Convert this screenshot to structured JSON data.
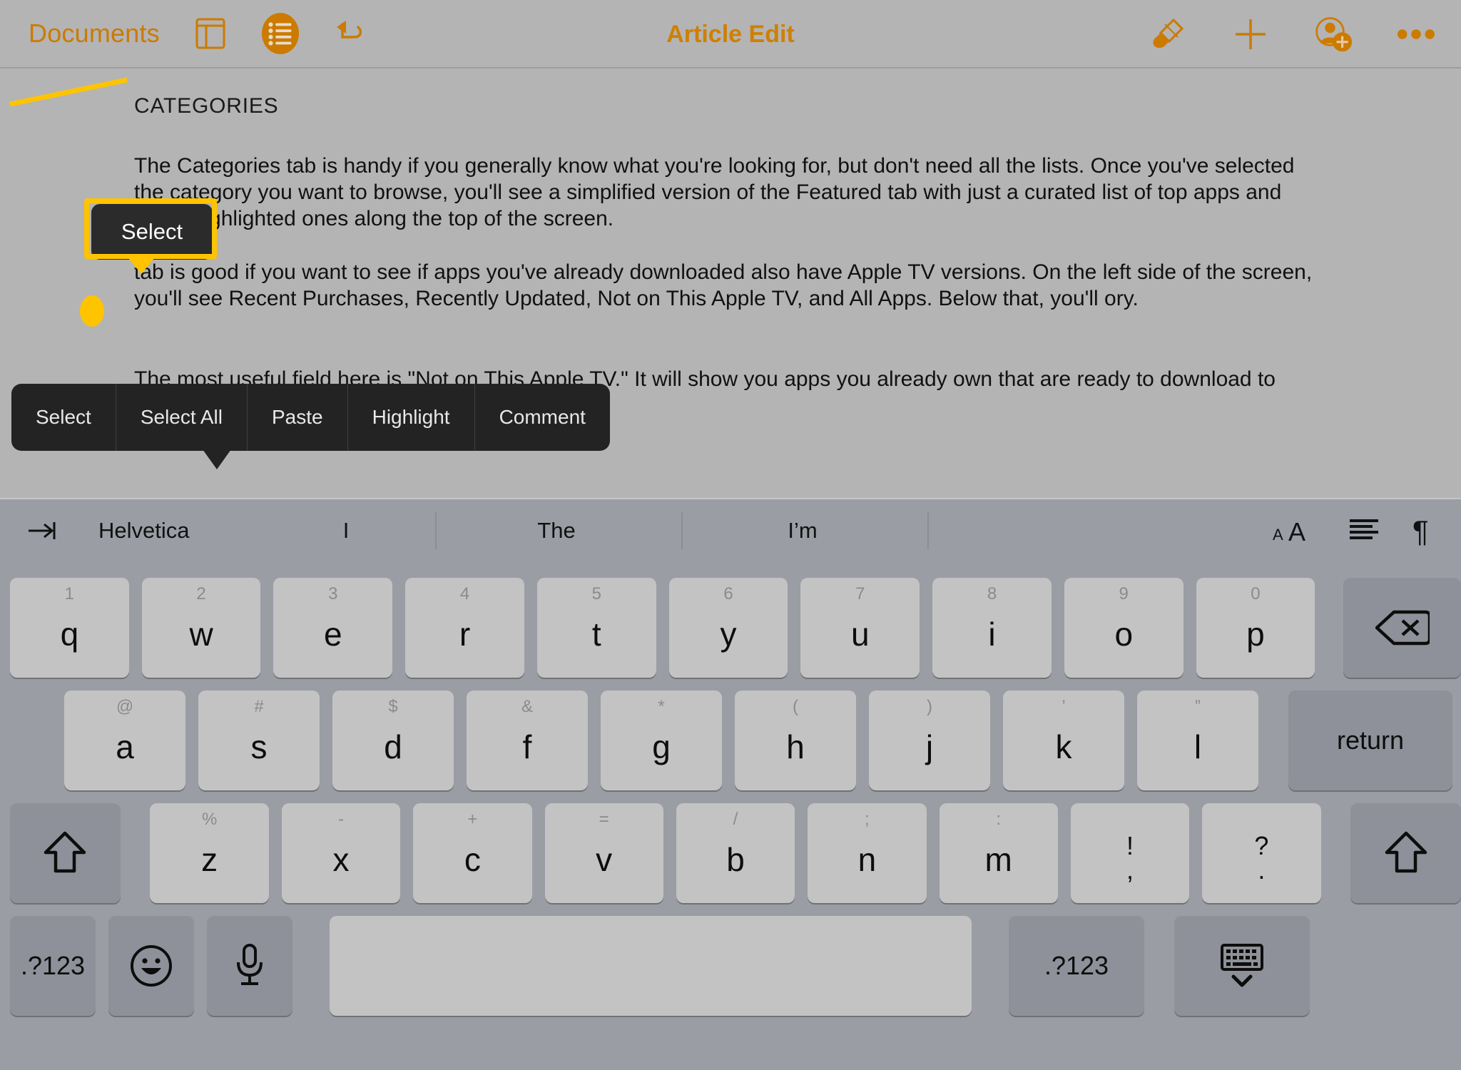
{
  "toolbar": {
    "back_label": "Documents",
    "title": "Article Edit",
    "icons": {
      "layout": "layout-panel-icon",
      "list": "bulleted-list-icon",
      "undo": "undo-arrow-icon",
      "brush": "paintbrush-icon",
      "plus": "plus-icon",
      "add_person": "add-person-icon",
      "more": "ellipsis-icon"
    }
  },
  "document": {
    "heading": "CATEGORIES",
    "paragraph1": "The Categories tab is handy if you generally know what you're looking for, but don't need all the lists. Once you've selected the category you want to browse, you'll see a simplified version of the Featured tab with just a curated list of top apps and some highlighted ones along the top of the screen.",
    "paragraph2": "tab is good if you want to see if apps you've already downloaded also have Apple TV versions. On the left side of the screen, you'll see Recent Purchases, Recently Updated, Not on This Apple TV, and All Apps. Below that, you'll ory.",
    "paragraph3": "The most useful field here is \"Not on This Apple TV.\" It will show you apps you already own that are ready to download to your Apple TV."
  },
  "callout": {
    "label": "Select",
    "highlight_color": "#FFC400"
  },
  "context_menu": {
    "items": [
      {
        "label": "Select"
      },
      {
        "label": "Select All"
      },
      {
        "label": "Paste"
      },
      {
        "label": "Highlight"
      },
      {
        "label": "Comment"
      }
    ]
  },
  "keyboard": {
    "suggestion_bar": {
      "tab_icon": "tab-arrow-icon",
      "font_name": "Helvetica",
      "suggestions": [
        "I",
        "The",
        "I’m"
      ],
      "right_icons": {
        "text_size": "text-size-icon",
        "align": "align-left-icon",
        "paragraph": "pilcrow-icon"
      }
    },
    "row1": [
      {
        "alt": "1",
        "main": "q"
      },
      {
        "alt": "2",
        "main": "w"
      },
      {
        "alt": "3",
        "main": "e"
      },
      {
        "alt": "4",
        "main": "r"
      },
      {
        "alt": "5",
        "main": "t"
      },
      {
        "alt": "6",
        "main": "y"
      },
      {
        "alt": "7",
        "main": "u"
      },
      {
        "alt": "8",
        "main": "i"
      },
      {
        "alt": "9",
        "main": "o"
      },
      {
        "alt": "0",
        "main": "p"
      }
    ],
    "row1_backspace": "backspace-icon",
    "row2": [
      {
        "alt": "@",
        "main": "a"
      },
      {
        "alt": "#",
        "main": "s"
      },
      {
        "alt": "$",
        "main": "d"
      },
      {
        "alt": "&",
        "main": "f"
      },
      {
        "alt": "*",
        "main": "g"
      },
      {
        "alt": "(",
        "main": "h"
      },
      {
        "alt": ")",
        "main": "j"
      },
      {
        "alt": "’",
        "main": "k"
      },
      {
        "alt": "”",
        "main": "l"
      }
    ],
    "row2_return": "return",
    "row3": [
      {
        "alt": "%",
        "main": "z"
      },
      {
        "alt": "-",
        "main": "x"
      },
      {
        "alt": "+",
        "main": "c"
      },
      {
        "alt": "=",
        "main": "v"
      },
      {
        "alt": "/",
        "main": "b"
      },
      {
        "alt": ";",
        "main": "n"
      },
      {
        "alt": ":",
        "main": "m"
      }
    ],
    "row3_punct": [
      {
        "top": "!",
        "bottom": ","
      },
      {
        "top": "?",
        "bottom": "."
      }
    ],
    "row3_shift_left": "shift-icon",
    "row3_shift_right": "shift-icon",
    "row4": {
      "numbers_left": ".?123",
      "emoji": "emoji-smiley-icon",
      "dictation": "microphone-icon",
      "space": "",
      "numbers_right": ".?123",
      "dismiss": "hide-keyboard-icon"
    }
  }
}
